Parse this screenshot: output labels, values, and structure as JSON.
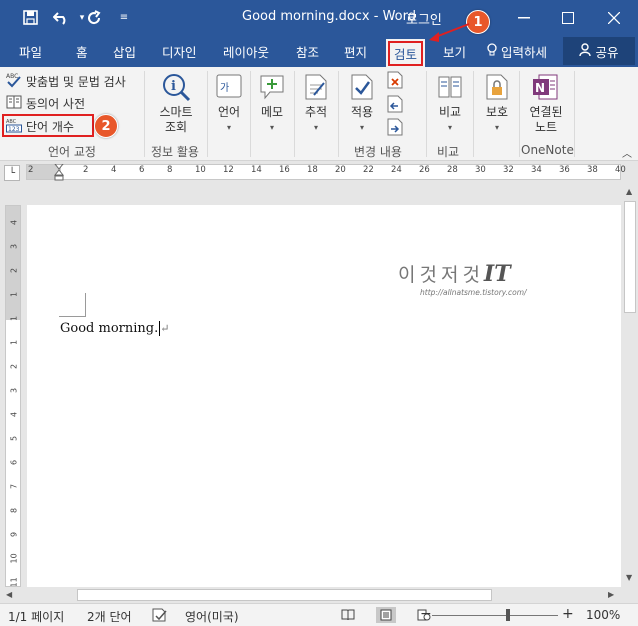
{
  "titlebar": {
    "title": "Good morning.docx - Word",
    "login": "로그인",
    "save_icon": "save-icon",
    "undo_icon": "undo-icon",
    "redo_icon": "redo-icon",
    "customize_icon": "customize-icon"
  },
  "tabs": [
    {
      "label": "파일"
    },
    {
      "label": "홈"
    },
    {
      "label": "삽입"
    },
    {
      "label": "디자인"
    },
    {
      "label": "레이아웃"
    },
    {
      "label": "참조"
    },
    {
      "label": "편지"
    },
    {
      "label": "검토"
    },
    {
      "label": "보기"
    },
    {
      "label": "입력하세"
    }
  ],
  "share_label": "공유",
  "ribbon": {
    "proofing": {
      "spell": "맞춤법 및 문법 검사",
      "thesaurus": "동의어 사전",
      "wordcount": "단어 개수",
      "label": "언어 교정"
    },
    "insights": {
      "smart1": "스마트",
      "smart2": "조회",
      "label": "정보 활용"
    },
    "language": {
      "label": "언어"
    },
    "comments": {
      "label": "메모"
    },
    "tracking": {
      "label": "추적"
    },
    "changes": {
      "accept": "적용",
      "label": "변경 내용"
    },
    "compare": {
      "cmd": "비교",
      "label": "비교"
    },
    "protect": {
      "cmd": "보호"
    },
    "onenote": {
      "l1": "연결된",
      "l2": "노트",
      "label": "OneNote"
    }
  },
  "annotations": {
    "step1": "1",
    "step2": "2"
  },
  "hruler_ticks": [
    "2",
    "2",
    "4",
    "6",
    "8",
    "10",
    "12",
    "14",
    "16",
    "18",
    "20",
    "22",
    "24",
    "26",
    "28",
    "30",
    "32",
    "34",
    "36",
    "38",
    "40"
  ],
  "vruler_ticks": [
    "4",
    "3",
    "2",
    "1",
    "1",
    "1",
    "2",
    "3",
    "4",
    "5",
    "6",
    "7",
    "8",
    "9",
    "10",
    "11"
  ],
  "document": {
    "text": "Good morning.",
    "para_mark": "↵",
    "watermark_korean": "이것저것",
    "watermark_it": "IT",
    "watermark_url": "http://allnatsme.tistory.com/"
  },
  "status": {
    "page": "1/1 페이지",
    "words": "2개 단어",
    "language": "영어(미국)",
    "zoom_minus": "−",
    "zoom_plus": "+",
    "zoom": "100%"
  },
  "colors": {
    "accent": "#2b579a",
    "highlight": "#e02020",
    "badge": "#e8572a"
  }
}
